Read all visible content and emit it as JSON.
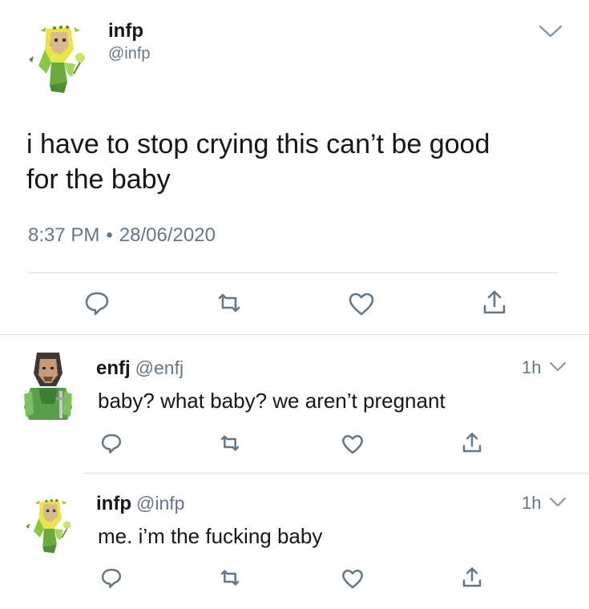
{
  "main_tweet": {
    "name": "infp",
    "handle": "@infp",
    "avatar_icon": "infp-elf-avatar-icon",
    "text_line1": "i have to stop crying this can’t be good",
    "text_line2": "for the baby",
    "time": "8:37 PM",
    "date": "28/06/2020",
    "separator": "•",
    "actions": [
      "reply-icon",
      "retweet-icon",
      "like-icon",
      "share-icon"
    ]
  },
  "replies": [
    {
      "name": "enfj",
      "handle": "@enfj",
      "age": "1h",
      "avatar_icon": "enfj-warrior-avatar-icon",
      "text": "baby? what baby? we aren’t pregnant"
    },
    {
      "name": "infp",
      "handle": "@infp",
      "age": "1h",
      "avatar_icon": "infp-elf-avatar-icon",
      "text": "me. i’m the fucking baby"
    }
  ],
  "colors": {
    "text": "#14171a",
    "secondary": "#657786",
    "divider": "#d5dbe0",
    "avatar_green": "#8cc63f",
    "avatar_yellow": "#e9e44b"
  }
}
